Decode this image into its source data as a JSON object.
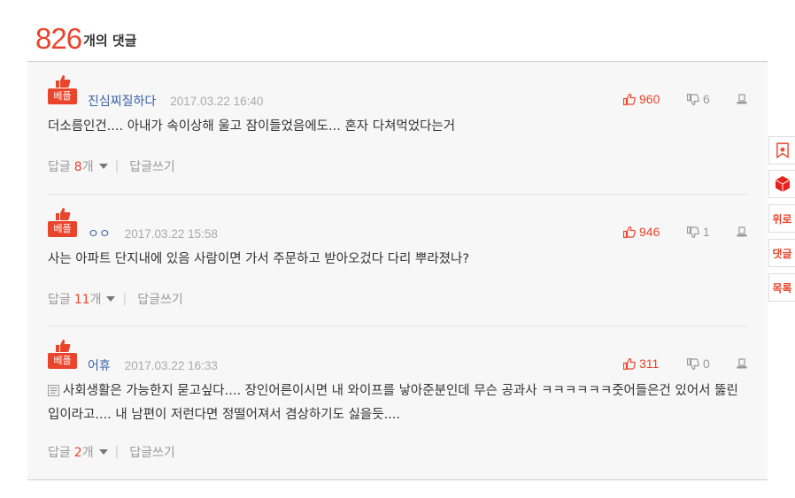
{
  "header": {
    "count": "826",
    "suffix": "개의 댓글"
  },
  "best_label": "베플",
  "reply_label": "답글",
  "reply_unit": "개",
  "write_label": "답글쓰기",
  "comments": [
    {
      "author": "진심찌질하다",
      "date": "2017.03.22 16:40",
      "up": "960",
      "down": "6",
      "text": "더소름인건.... 아내가 속이상해 울고 잠이들었음에도... 혼자 다쳐먹었다는거",
      "replies": "8"
    },
    {
      "author": "ㅇㅇ",
      "date": "2017.03.22 15:58",
      "up": "946",
      "down": "1",
      "text": "사는 아파트 단지내에 있음 사람이면 가서 주문하고 받아오겄다 다리 뿌라졌나?",
      "replies": "11"
    },
    {
      "author": "어휴",
      "date": "2017.03.22 16:33",
      "up": "311",
      "down": "0",
      "text": "사회생활은 가능한지 묻고싶다.... 장인어른이시면 내 와이프를 낳아준분인데 무슨 공과사 ㅋㅋㅋㅋㅋㅋ줏어들은건 있어서 뚫린입이라고.... 내 남편이 저런다면 정떨어져서 겸상하기도 싫을듯....",
      "replies": "2"
    }
  ],
  "side_menu": {
    "item3": "위로",
    "item4": "댓글",
    "item5": "목록"
  },
  "colors": {
    "accent": "#e8452c",
    "author": "#3a63a8",
    "muted": "#999999",
    "panel": "#f7f7f7"
  }
}
